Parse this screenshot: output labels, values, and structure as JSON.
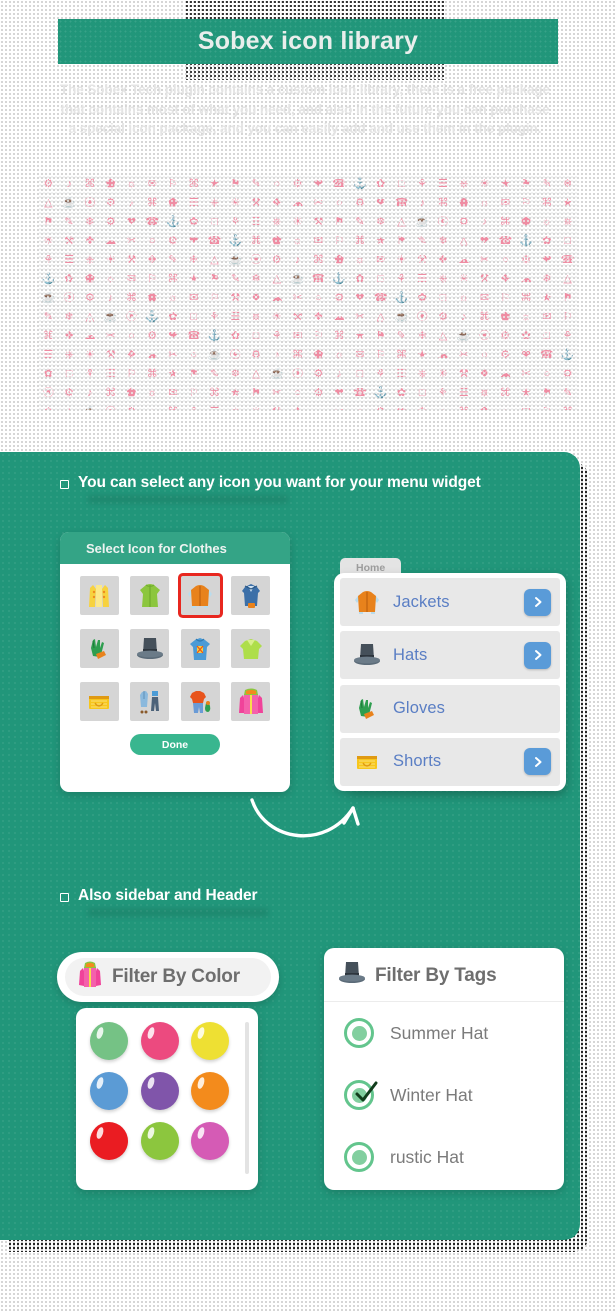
{
  "header": {
    "title": "Sobex icon library"
  },
  "subtitle": "The Sobex Tech plugin contains a custom icon library, there is a free package that contains most of what you need, and also in the future you can purchase a special icon package, and you can easily add and use them in the plugin.",
  "colors": {
    "brand_green": "#21967a",
    "header_green": "#34a486",
    "done_green": "#39b68f",
    "selected_red": "#e8271f",
    "menu_blue": "#5a7ec4",
    "arrow_blue": "#5a9bd8",
    "map_icon_pink": "#f0879f"
  },
  "sections": [
    {
      "id": "select-icon",
      "label": "You can select any icon you want for your menu widget"
    },
    {
      "id": "sidebar-header",
      "label": "Also sidebar and Header"
    }
  ],
  "select_icon_card": {
    "title": "Select Icon for Clothes",
    "done_label": "Done",
    "selected_index": 2,
    "icons": [
      {
        "name": "vest-icon"
      },
      {
        "name": "green-coat-icon"
      },
      {
        "name": "orange-jacket-icon"
      },
      {
        "name": "blue-blouse-icon"
      },
      {
        "name": "gloves-icon"
      },
      {
        "name": "top-hat-icon"
      },
      {
        "name": "blue-tshirt-icon"
      },
      {
        "name": "green-sweater-icon"
      },
      {
        "name": "shorts-icon"
      },
      {
        "name": "outfit-icon"
      },
      {
        "name": "sweater-jeans-icon"
      },
      {
        "name": "pink-hoodie-icon"
      }
    ]
  },
  "menu_widget": {
    "tab_label": "Home",
    "rows": [
      {
        "label": "Jackets",
        "icon": "orange-jacket-icon",
        "has_arrow": true
      },
      {
        "label": "Hats",
        "icon": "top-hat-icon",
        "has_arrow": true
      },
      {
        "label": "Gloves",
        "icon": "gloves-icon",
        "has_arrow": false
      },
      {
        "label": "Shorts",
        "icon": "shorts-icon",
        "has_arrow": true
      }
    ]
  },
  "filter_by_color": {
    "label": "Filter By Color",
    "icon": "pink-hoodie-icon",
    "swatches": [
      {
        "name": "green",
        "hex": "#75c285"
      },
      {
        "name": "pink",
        "hex": "#ec4a7f"
      },
      {
        "name": "yellow",
        "hex": "#eee033"
      },
      {
        "name": "blue",
        "hex": "#5b9bd5"
      },
      {
        "name": "purple",
        "hex": "#8055aa"
      },
      {
        "name": "orange",
        "hex": "#f38b1c"
      },
      {
        "name": "red",
        "hex": "#ea1c22"
      },
      {
        "name": "lime",
        "hex": "#8cc63e"
      },
      {
        "name": "magenta",
        "hex": "#d55bb5"
      }
    ]
  },
  "filter_by_tags": {
    "label": "Filter By Tags",
    "icon": "top-hat-icon",
    "options": [
      {
        "label": "Summer Hat",
        "selected": false
      },
      {
        "label": "Winter Hat",
        "selected": true
      },
      {
        "label": "rustic Hat",
        "selected": false
      }
    ]
  }
}
